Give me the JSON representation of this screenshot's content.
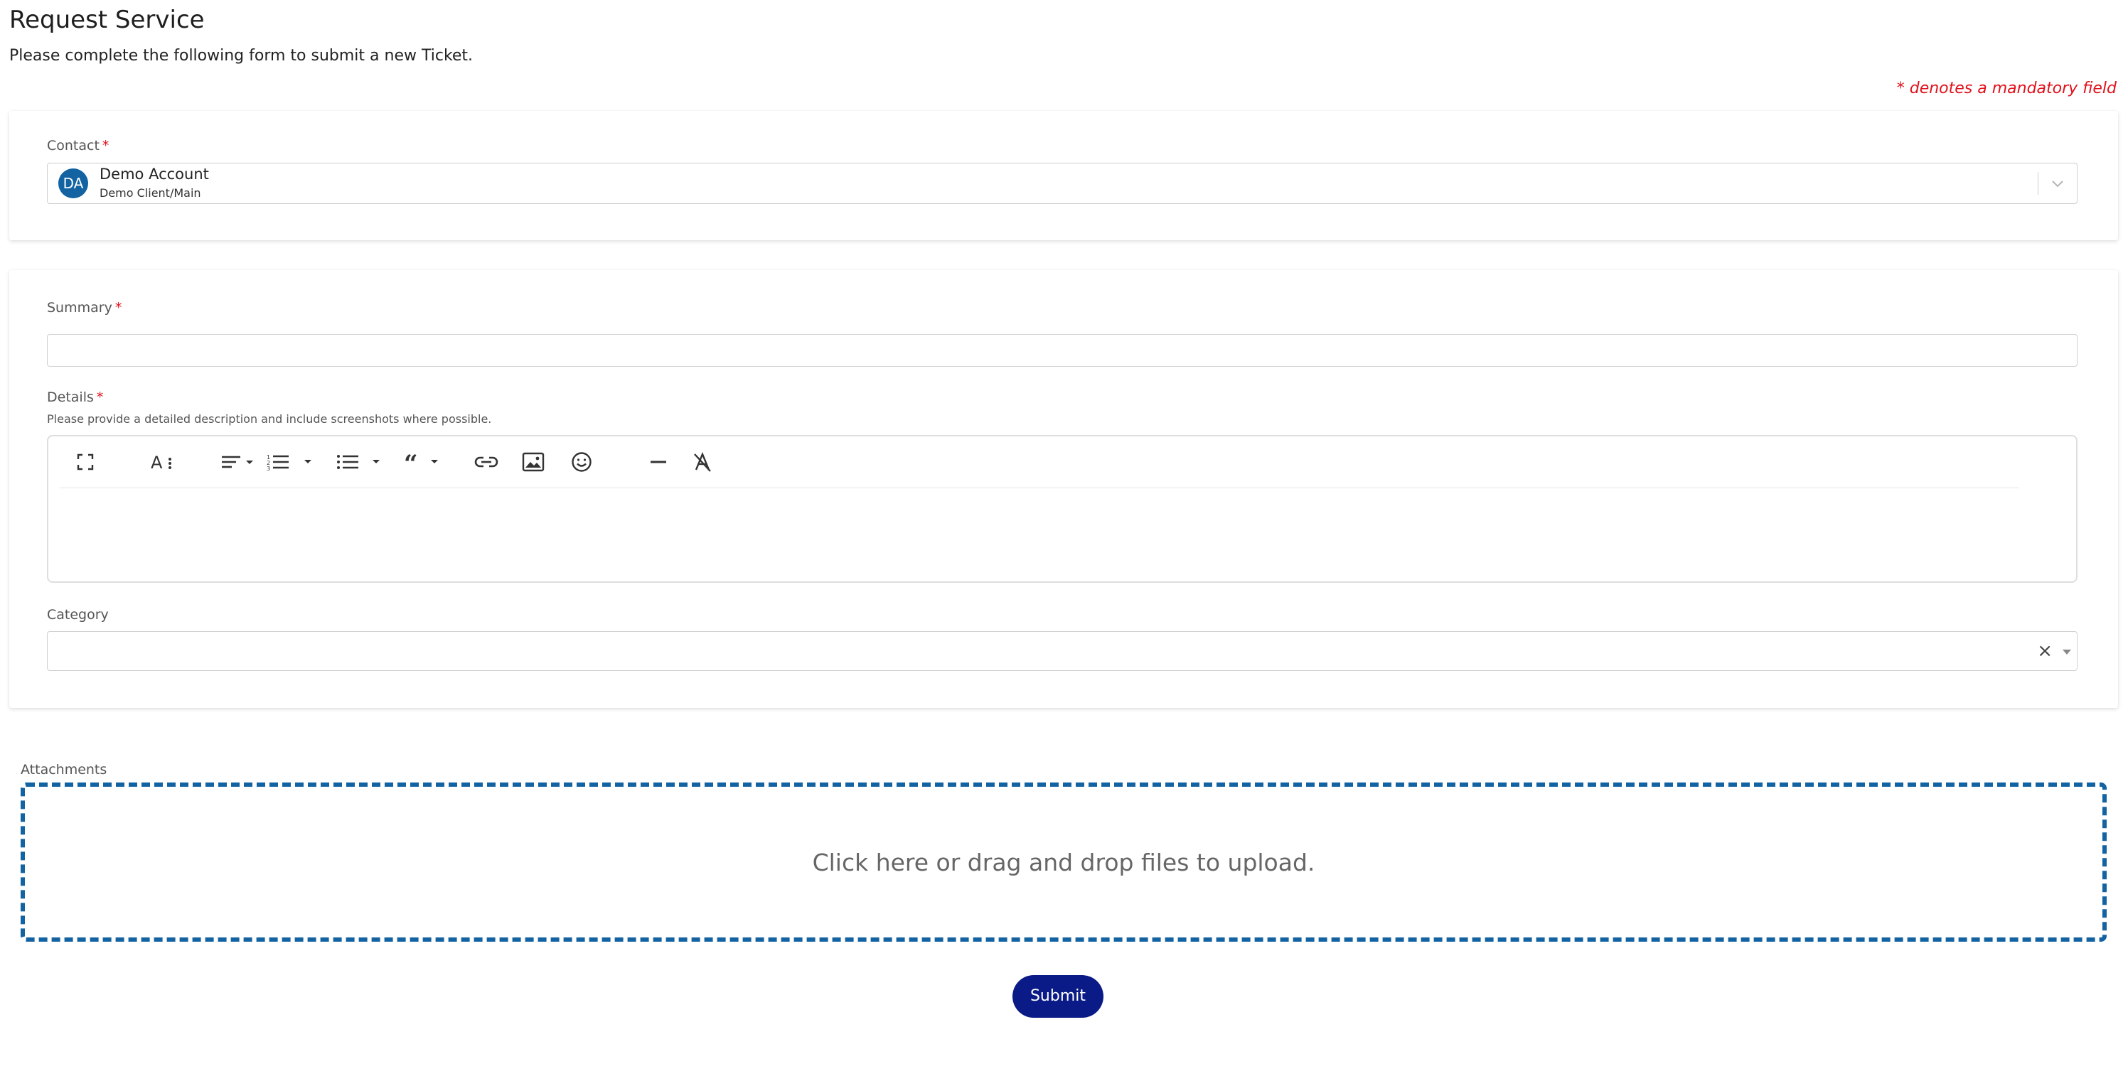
{
  "page": {
    "title": "Request Service",
    "subtitle": "Please complete the following form to submit a new Ticket.",
    "mandatory_note": "* denotes a mandatory field"
  },
  "contact": {
    "label": "Contact",
    "required_marker": "*",
    "avatar_initials": "DA",
    "name": "Demo Account",
    "sub": "Demo Client/Main"
  },
  "summary": {
    "label": "Summary",
    "required_marker": "*",
    "value": ""
  },
  "details": {
    "label": "Details",
    "required_marker": "*",
    "help": "Please provide a detailed description and include screenshots where possible.",
    "toolbar": [
      {
        "name": "fullscreen-icon"
      },
      {
        "name": "font-size-icon"
      },
      {
        "name": "align-icon",
        "dropdown": true
      },
      {
        "name": "ordered-list-icon",
        "dropdown": true
      },
      {
        "name": "unordered-list-icon",
        "dropdown": true
      },
      {
        "name": "blockquote-icon",
        "dropdown": true
      },
      {
        "name": "link-icon"
      },
      {
        "name": "image-icon"
      },
      {
        "name": "emoji-icon"
      },
      {
        "name": "horizontal-rule-icon"
      },
      {
        "name": "clear-format-icon"
      }
    ],
    "value": ""
  },
  "category": {
    "label": "Category",
    "value": "",
    "clear_symbol": "×"
  },
  "attachments": {
    "label": "Attachments",
    "dropzone_text": "Click here or drag and drop files to upload."
  },
  "submit": {
    "label": "Submit"
  },
  "colors": {
    "accent": "#1363a3",
    "submit": "#0a1a86",
    "required": "#e0111b"
  }
}
